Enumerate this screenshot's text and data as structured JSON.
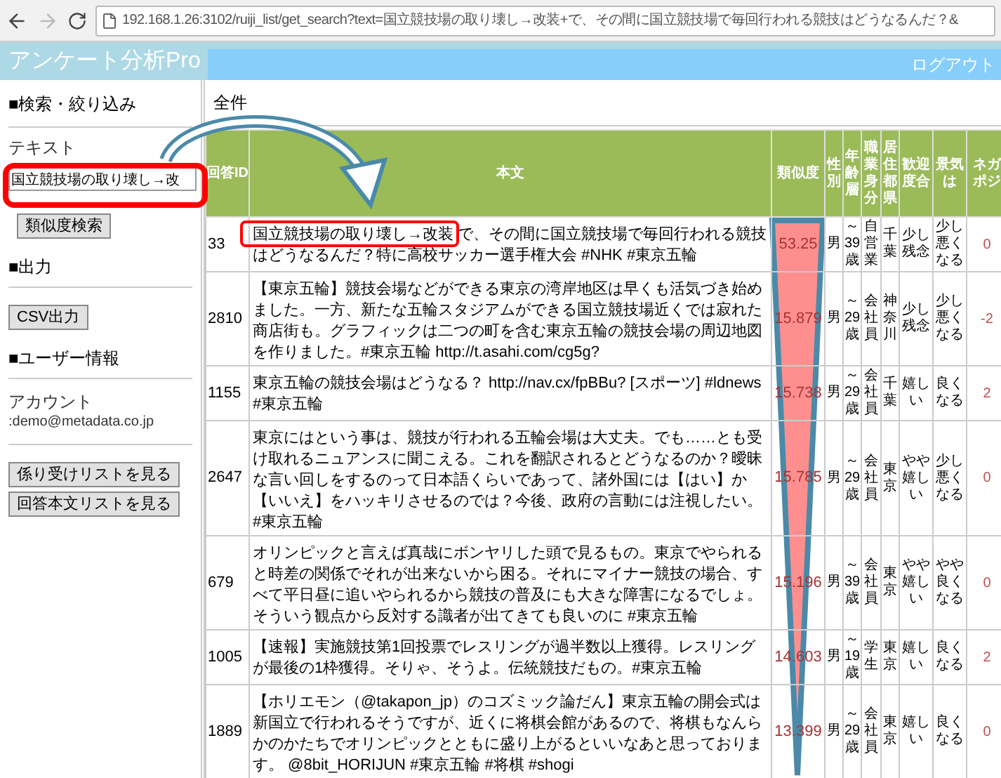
{
  "browser": {
    "url": "192.168.1.26:3102/ruiji_list/get_search?text=国立競技場の取り壊し→改装+で、その間に国立競技場で毎回行われる競技はどうなるんだ？&",
    "forward_enabled": false
  },
  "app_title": "アンケート分析Pro",
  "logout": "ログアウト",
  "sidebar": {
    "search_heading": "■検索・絞り込み",
    "text_label": "テキスト",
    "text_value": "国立競技場の取り壊し→改",
    "search_button": "類似度検索",
    "output_heading": "■出力",
    "csv_button": "CSV出力",
    "user_heading": "■ユーザー情報",
    "account_label": "アカウント",
    "account_value": ":demo@metadata.co.jp",
    "buttons": [
      "係り受けリストを見る",
      "回答本文リストを見る"
    ]
  },
  "result_heading": "全件",
  "table": {
    "columns": [
      "回答ID",
      "本文",
      "類似度",
      "性別",
      "年齢層",
      "職業身分",
      "居住都県",
      "歓迎度合",
      "景気は",
      "ネガポジ"
    ],
    "rows": [
      [
        "33",
        "国立競技場の取り壊し→改装 で、その間に国立競技場で毎回行われる競技はどうなるんだ？特に高校サッカー選手権大会 #NHK #東京五輪",
        "53.25",
        "男",
        "～39歳",
        "自営業",
        "千葉",
        "少し残念",
        "少し悪くなる",
        "0"
      ],
      [
        "2810",
        "【東京五輪】競技会場などができる東京の湾岸地区は早くも活気づき始めました。一方、新たな五輪スタジアムができる国立競技場近くでは寂れた商店街も。グラフィックは二つの町を含む東京五輪の競技会場の周辺地図を作りました。#東京五輪 http://t.asahi.com/cg5g?",
        "15.879",
        "男",
        "～29歳",
        "会社員",
        "神奈川",
        "少し残念",
        "少し悪くなる",
        "-2"
      ],
      [
        "1155",
        "東京五輪の競技会場はどうなる？ http://nav.cx/fpBBu? [スポーツ] #ldnews #東京五輪",
        "15.738",
        "男",
        "～29歳",
        "会社員",
        "千葉",
        "嬉しい",
        "良くなる",
        "2"
      ],
      [
        "2647",
        "東京にはという事は、競技が行われる五輪会場は大丈夫。でも……とも受け取れるニュアンスに聞こえる。これを翻訳されるとどうなるのか？曖昧な言い回しをするのって日本語くらいであって、諸外国には【はい】か【いいえ】をハッキリさせるのでは？今後、政府の言動には注視したい。#東京五輪",
        "15.785",
        "男",
        "～29歳",
        "会社員",
        "東京",
        "やや嬉しい",
        "少し悪くなる",
        "0"
      ],
      [
        "679",
        "オリンピックと言えば真哉にボンヤリした頭で見るもの。東京でやられると時差の関係でそれが出来ないから困る。それにマイナー競技の場合、すべて平日昼に追いやられるから競技の普及にも大きな障害になるでしょ。そういう観点から反対する識者が出てきても良いのに #東京五輪",
        "15.196",
        "男",
        "～39歳",
        "会社員",
        "東京",
        "やや嬉しい",
        "やや良くなる",
        "0"
      ],
      [
        "1005",
        "【速報】実施競技第1回投票でレスリングが過半数以上獲得。レスリングが最後の1枠獲得。そりゃ、そうよ。伝統競技だもの。#東京五輪",
        "14.603",
        "男",
        "～19歳",
        "学生",
        "東京",
        "嬉しい",
        "良くなる",
        "2"
      ],
      [
        "1889",
        "【ホリエモン（@takapon_jp）のコズミック論だん】東京五輪の開会式は新国立で行われるそうですが、近くに将棋会館があるので、将棋もなんらかのかたちでオリンピックとともに盛り上がるといいなあと思っております。 @8bit_HORIJUN #東京五輪 #将棋 #shogi",
        "13.399",
        "男",
        "～29歳",
        "会社員",
        "東京",
        "嬉しい",
        "良くなる",
        "0"
      ]
    ]
  }
}
